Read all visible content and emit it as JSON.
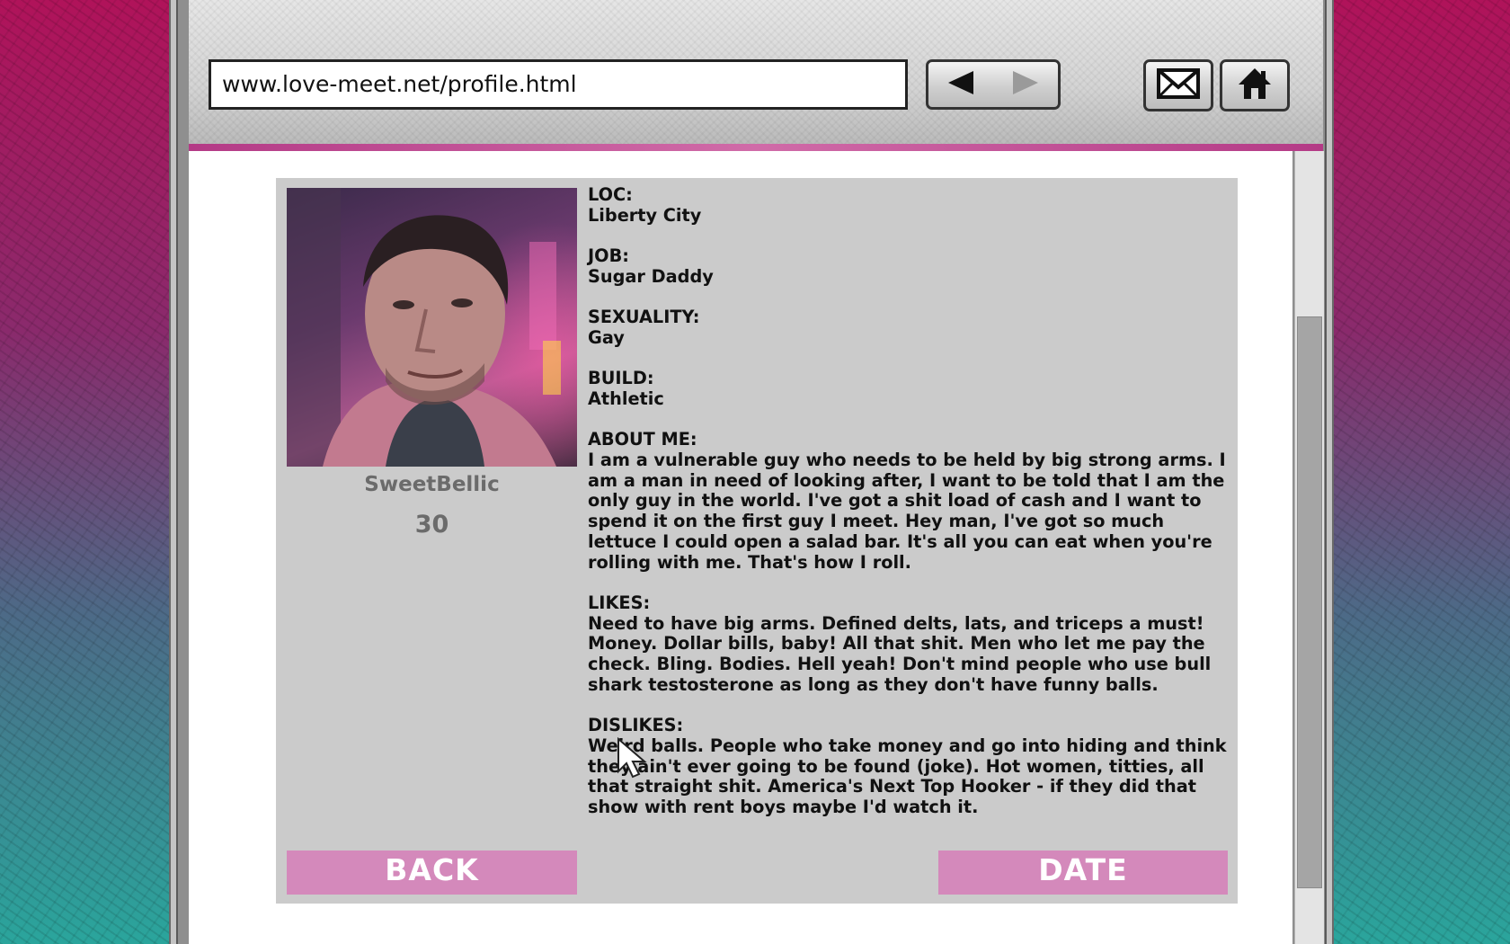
{
  "browser": {
    "url": "www.love-meet.net/profile.html",
    "back_icon": "left-arrow-icon",
    "forward_icon": "right-arrow-icon",
    "mail_icon": "envelope-icon",
    "home_icon": "house-icon"
  },
  "profile": {
    "username": "SweetBellic",
    "age": "30",
    "sections": [
      {
        "label": "LOC:",
        "value": "Liberty City"
      },
      {
        "label": "JOB:",
        "value": "Sugar Daddy"
      },
      {
        "label": "SEXUALITY:",
        "value": "Gay"
      },
      {
        "label": "BUILD:",
        "value": "Athletic"
      },
      {
        "label": "ABOUT ME:",
        "value": "I am a vulnerable guy who needs to be held by big strong arms. I am a man in need of looking after, I want to be told that I am the only guy in the world. I've got a shit load of cash and I want to spend it on the first guy I meet. Hey man, I've got so much lettuce I could open a salad bar. It's all you can eat when you're rolling with me. That's how I roll."
      },
      {
        "label": "LIKES:",
        "value": "Need to have big arms. Defined delts, lats, and triceps a must! Money. Dollar bills, baby! All that shit. Men who let me pay the check. Bling. Bodies. Hell yeah! Don't mind people who use bull shark testosterone as long as they don't have funny balls."
      },
      {
        "label": "DISLIKES:",
        "value": "Weird balls. People who take money and go into hiding and think they ain't ever going to be found (joke). Hot women, titties, all that straight shit. America's Next Top Hooker - if they did that show with rent boys maybe I'd watch it."
      }
    ]
  },
  "actions": {
    "back_label": "BACK",
    "date_label": "DATE"
  },
  "colors": {
    "accent_pink": "#d489bb",
    "card_bg": "#cbcbcb"
  }
}
